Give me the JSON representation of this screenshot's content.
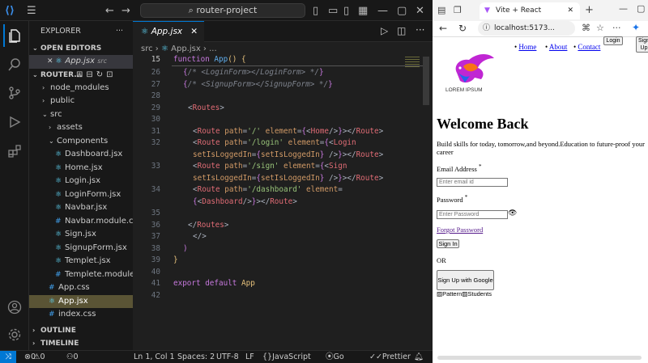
{
  "vscode": {
    "search": "router-project",
    "sidebar": {
      "title": "EXPLORER",
      "open_editors": "OPEN EDITORS",
      "open_file": "App.jsx",
      "open_file_dir": "src",
      "project": "ROUTER...",
      "tree": [
        {
          "label": "node_modules",
          "indent": 1,
          "kind": "folder",
          "chev": "›"
        },
        {
          "label": "public",
          "indent": 1,
          "kind": "folder",
          "chev": "›"
        },
        {
          "label": "src",
          "indent": 1,
          "kind": "folder",
          "chev": "⌄"
        },
        {
          "label": "assets",
          "indent": 2,
          "kind": "folder",
          "chev": "›"
        },
        {
          "label": "Components",
          "indent": 2,
          "kind": "folder",
          "chev": "⌄"
        },
        {
          "label": "Dashboard.jsx",
          "indent": 3,
          "kind": "jsx"
        },
        {
          "label": "Home.jsx",
          "indent": 3,
          "kind": "jsx"
        },
        {
          "label": "Login.jsx",
          "indent": 3,
          "kind": "jsx"
        },
        {
          "label": "LoginForm.jsx",
          "indent": 3,
          "kind": "jsx"
        },
        {
          "label": "Navbar.jsx",
          "indent": 3,
          "kind": "jsx"
        },
        {
          "label": "Navbar.module.css",
          "indent": 3,
          "kind": "css"
        },
        {
          "label": "Sign.jsx",
          "indent": 3,
          "kind": "jsx"
        },
        {
          "label": "SignupForm.jsx",
          "indent": 3,
          "kind": "jsx"
        },
        {
          "label": "Templet.jsx",
          "indent": 3,
          "kind": "jsx"
        },
        {
          "label": "Templete.module.css",
          "indent": 3,
          "kind": "css"
        },
        {
          "label": "App.css",
          "indent": 2,
          "kind": "css"
        },
        {
          "label": "App.jsx",
          "indent": 2,
          "kind": "jsx",
          "active": true
        },
        {
          "label": "index.css",
          "indent": 2,
          "kind": "css"
        }
      ],
      "outline": "OUTLINE",
      "timeline": "TIMELINE"
    },
    "tab": "App.jsx",
    "breadcrumb": [
      "src",
      "App.jsx",
      "..."
    ],
    "lines": [
      "15",
      "26",
      "27",
      "28",
      "29",
      "30",
      "31",
      "32",
      "",
      "33",
      "",
      "34",
      "",
      "35",
      "36",
      "37",
      "38",
      "39",
      "40",
      "41",
      "42"
    ],
    "status": {
      "errors": "0",
      "warnings": "0",
      "ports": "0",
      "position": "Ln 1, Col 1",
      "spaces": "Spaces: 2",
      "encoding": "UTF-8",
      "eol": "LF",
      "language": "JavaScript JSX",
      "golive": "Go Live",
      "prettier": "Prettier"
    }
  },
  "browser": {
    "tab_title": "Vite + React",
    "url": "localhost:5173...",
    "nav": [
      "Home",
      "About",
      "Contact"
    ],
    "login_btn": "Login",
    "signup_btn": "Sign Up",
    "logo_text": "LOREM IPSUM",
    "heading": "Welcome Back",
    "subtitle": "Build skills for today, tomorrow,and beyond.Education to future-proof your career",
    "email_label": "Email Address",
    "email_placeholder": "Enter email id",
    "password_label": "Password",
    "password_placeholder": "Enter Password",
    "forgot": "Forgot Password",
    "signin": "Sign In",
    "or": "OR",
    "google": "Sign Up with Google",
    "broken_images": [
      "Pattern",
      "Students"
    ]
  },
  "colors": {
    "accent": "#0078d4",
    "active_file_bg": "#5a5435"
  }
}
